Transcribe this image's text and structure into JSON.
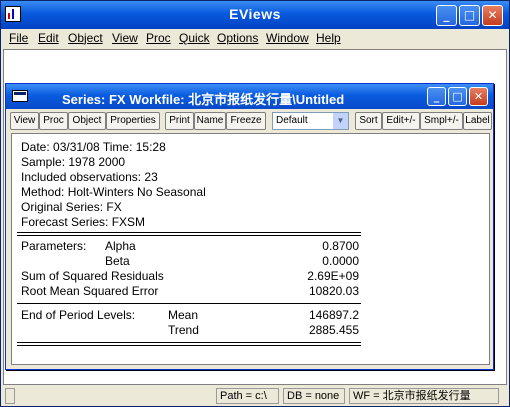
{
  "app": {
    "title": "EViews",
    "menu": [
      "File",
      "Edit",
      "Object",
      "View",
      "Proc",
      "Quick",
      "Options",
      "Window",
      "Help"
    ],
    "caption_buttons": {
      "minimize": "_",
      "maximize": "□",
      "close": "✕"
    }
  },
  "series_window": {
    "title": "Series: FX   Workfile: 北京市报纸发行量\\Untitled",
    "toolbar": [
      "View",
      "Proc",
      "Object",
      "Properties",
      "Print",
      "Name",
      "Freeze",
      "Sort",
      "Edit+/-",
      "Smpl+/-",
      "Label"
    ],
    "display_select": "Default",
    "output": {
      "date_line": "Date: 03/31/08   Time: 15:28",
      "sample": "Sample: 1978 2000",
      "included": "Included observations: 23",
      "method": "Method: Holt-Winters No Seasonal",
      "original": "Original Series: FX",
      "forecast": "Forecast Series: FXSM",
      "parameters_label": "Parameters:",
      "alpha_label": "Alpha",
      "alpha_value": "0.8700",
      "beta_label": "Beta",
      "beta_value": "0.0000",
      "ssr_label": "Sum of Squared Residuals",
      "ssr_value": "2.69E+09",
      "rmse_label": "Root Mean Squared Error",
      "rmse_value": "10820.03",
      "end_levels_label": "End of Period Levels:",
      "mean_label": "Mean",
      "mean_value": "146897.2",
      "trend_label": "Trend",
      "trend_value": "2885.455"
    }
  },
  "statusbar": {
    "path": "Path = c:\\",
    "db": "DB = none",
    "wf": "WF = 北京市报纸发行量"
  },
  "colors": {
    "titlebar": "#0859de",
    "chrome": "#ece9d8"
  },
  "icons": [
    "eviews-app-icon",
    "series-window-icon",
    "minimize-icon",
    "maximize-icon",
    "close-icon",
    "dropdown-arrow-icon"
  ]
}
